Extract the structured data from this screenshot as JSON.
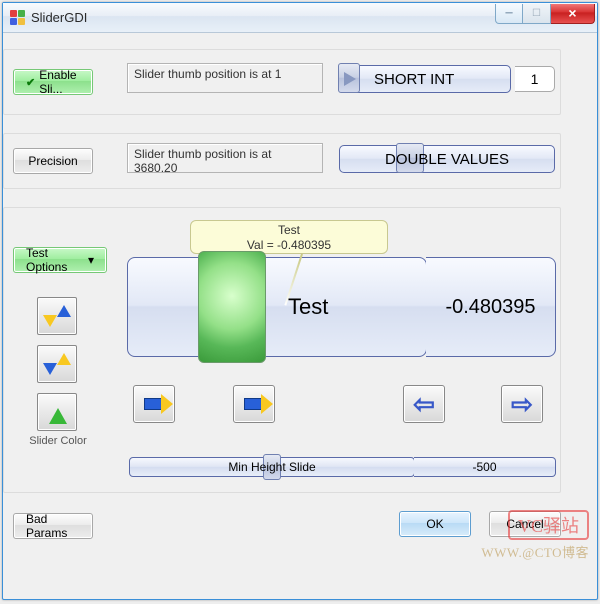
{
  "window": {
    "title": "SliderGDI"
  },
  "sidebar": {
    "enable": "Enable Sli...",
    "precision": "Precision",
    "testOptions": "Test Options",
    "sliderColor": "Slider Color",
    "badParams": "Bad Params"
  },
  "row1": {
    "status": "Slider thumb position is at 1",
    "sliderLabel": "SHORT INT",
    "sliderValue": "1"
  },
  "row2": {
    "status": "Slider thumb position is at 3680.20",
    "sliderLabel": "DOUBLE VALUES"
  },
  "bigslider": {
    "tooltipLine1": "Test",
    "tooltipLine2": "Val = -0.480395",
    "label": "Test",
    "value": "-0.480395"
  },
  "minheight": {
    "label": "Min Height Slide",
    "value": "-500"
  },
  "buttons": {
    "ok": "OK",
    "cancel": "Cancel"
  },
  "watermark": {
    "line1": "VC驿站",
    "line2": "WWW.@CTO博客"
  }
}
